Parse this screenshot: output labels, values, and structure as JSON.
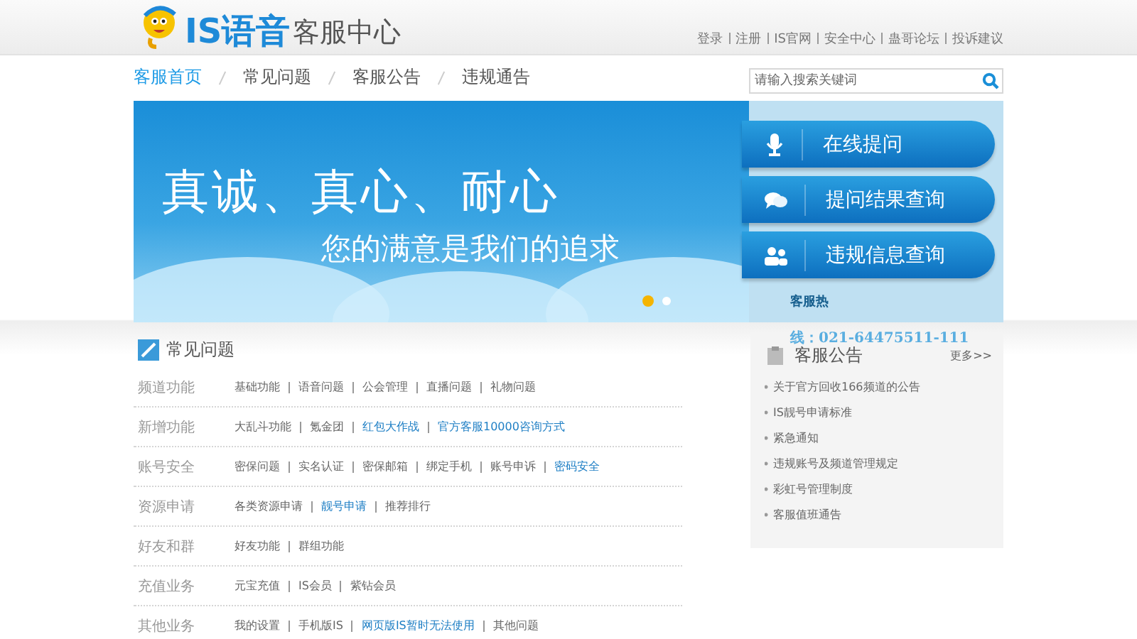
{
  "header": {
    "logo_text": "IS语音",
    "title": "客服中心",
    "top_links": [
      "登录",
      "注册",
      "IS官网",
      "安全中心",
      "蛊哥论坛",
      "投诉建议"
    ]
  },
  "nav": {
    "items": [
      {
        "label": "客服首页",
        "selected": true
      },
      {
        "label": "常见问题",
        "selected": false
      },
      {
        "label": "客服公告",
        "selected": false
      },
      {
        "label": "违规通告",
        "selected": false
      }
    ],
    "search": {
      "placeholder": "请输入搜索关键词"
    }
  },
  "banner": {
    "headline": "真诚、真心、耐心",
    "subline": "您的满意是我们的追求",
    "dots": [
      {
        "selected": true
      },
      {
        "selected": false
      }
    ]
  },
  "actions": [
    {
      "kind": "mic",
      "label": "在线提问"
    },
    {
      "kind": "chat",
      "label": "提问结果查询"
    },
    {
      "kind": "users",
      "label": "违规信息查询"
    }
  ],
  "hotline_lines": [
    "客服热",
    "线：021-64475511-111"
  ],
  "faq": {
    "title": "常见问题",
    "rows": [
      {
        "category": "频道功能",
        "links": [
          {
            "label": "基础功能",
            "highlighted": false
          },
          {
            "label": "语音问题",
            "highlighted": false
          },
          {
            "label": "公会管理",
            "highlighted": false
          },
          {
            "label": "直播问题",
            "highlighted": false
          },
          {
            "label": "礼物问题",
            "highlighted": false
          }
        ]
      },
      {
        "category": "新增功能",
        "links": [
          {
            "label": "大乱斗功能",
            "highlighted": false
          },
          {
            "label": "氪金团",
            "highlighted": false
          },
          {
            "label": "红包大作战",
            "highlighted": true
          },
          {
            "label": "官方客服10000咨询方式",
            "highlighted": true
          }
        ]
      },
      {
        "category": "账号安全",
        "links": [
          {
            "label": "密保问题",
            "highlighted": false
          },
          {
            "label": "实名认证",
            "highlighted": false
          },
          {
            "label": "密保邮箱",
            "highlighted": false
          },
          {
            "label": "绑定手机",
            "highlighted": false
          },
          {
            "label": "账号申诉",
            "highlighted": false
          },
          {
            "label": "密码安全",
            "highlighted": true
          }
        ]
      },
      {
        "category": "资源申请",
        "links": [
          {
            "label": "各类资源申请",
            "highlighted": false
          },
          {
            "label": "靓号申请",
            "highlighted": true
          },
          {
            "label": "推荐排行",
            "highlighted": false
          }
        ]
      },
      {
        "category": "好友和群",
        "links": [
          {
            "label": "好友功能",
            "highlighted": false
          },
          {
            "label": "群组功能",
            "highlighted": false
          }
        ]
      },
      {
        "category": "充值业务",
        "links": [
          {
            "label": "元宝充值",
            "highlighted": false
          },
          {
            "label": "IS会员",
            "highlighted": false
          },
          {
            "label": "紫钻会员",
            "highlighted": false
          }
        ]
      },
      {
        "category": "其他业务",
        "links": [
          {
            "label": "我的设置",
            "highlighted": false
          },
          {
            "label": "手机版IS",
            "highlighted": false
          },
          {
            "label": "网页版IS暂时无法使用",
            "highlighted": true
          },
          {
            "label": "其他问题",
            "highlighted": false
          }
        ]
      }
    ]
  },
  "notices": {
    "title": "客服公告",
    "more": "更多>>",
    "items": [
      "关于官方回收166频道的公告",
      "IS靓号申请标准",
      "紧急通知",
      "违规账号及频道管理规定",
      "彩虹号管理制度",
      "客服值班通告"
    ]
  }
}
